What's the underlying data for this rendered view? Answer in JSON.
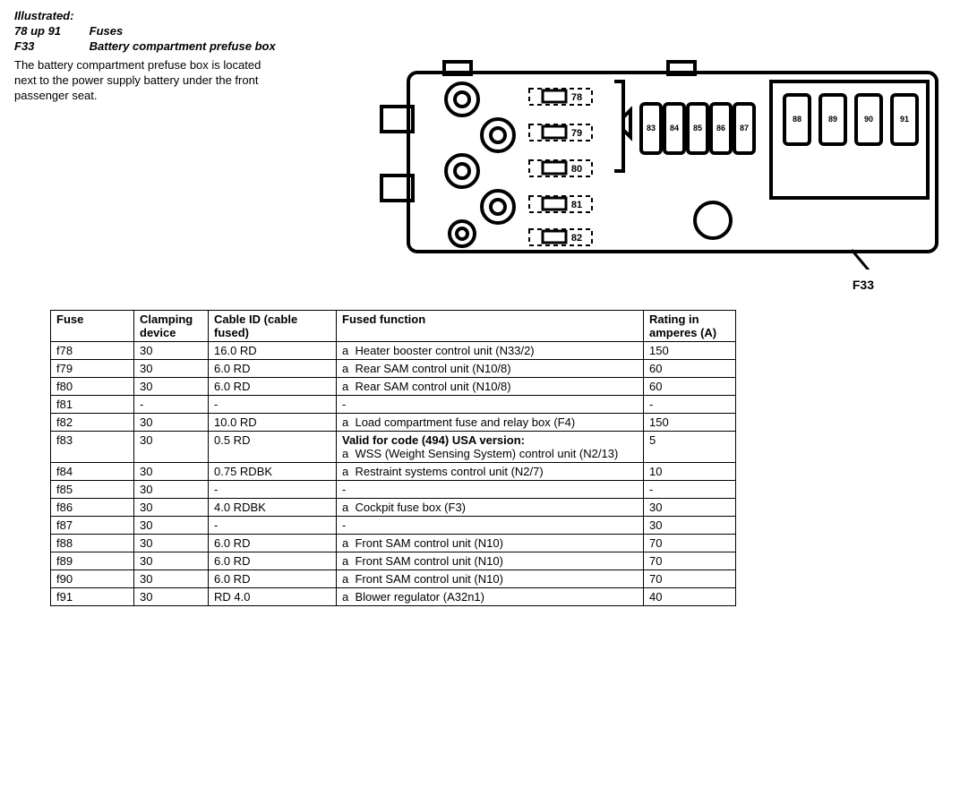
{
  "header": {
    "illustrated": "Illustrated:",
    "range_label": "78 up 91",
    "range_title": "Fuses",
    "component_id": "F33",
    "component_title": "Battery compartment prefuse box"
  },
  "description": "The battery compartment prefuse box is located next to the power supply battery under the front passenger seat.",
  "diagram": {
    "caption": "F33",
    "fuse_slots": [
      "78",
      "79",
      "80",
      "81",
      "82"
    ],
    "small_fuses": [
      "83",
      "84",
      "85",
      "86",
      "87"
    ],
    "right_fuses": [
      "88",
      "89",
      "90",
      "91"
    ]
  },
  "table": {
    "headers": {
      "fuse": "Fuse",
      "clamp": "Clamping device",
      "cable": "Cable ID (cable fused)",
      "func": "Fused function",
      "rating": "Rating in amperes (A)"
    },
    "rows": [
      {
        "fuse": "f78",
        "clamp": "30",
        "cable": "16.0 RD",
        "func": "Heater booster control unit (N33/2)",
        "func_bold": "",
        "rating": "150"
      },
      {
        "fuse": "f79",
        "clamp": "30",
        "cable": "6.0 RD",
        "func": "Rear SAM control unit (N10/8)",
        "func_bold": "",
        "rating": "60"
      },
      {
        "fuse": "f80",
        "clamp": "30",
        "cable": "6.0 RD",
        "func": "Rear SAM control unit (N10/8)",
        "func_bold": "",
        "rating": "60"
      },
      {
        "fuse": "f81",
        "clamp": "-",
        "cable": "-",
        "func": "-",
        "func_bold": "",
        "rating": "-"
      },
      {
        "fuse": "f82",
        "clamp": "30",
        "cable": "10.0 RD",
        "func": "Load compartment fuse and relay box (F4)",
        "func_bold": "",
        "rating": "150"
      },
      {
        "fuse": "f83",
        "clamp": "30",
        "cable": "0.5 RD",
        "func": "WSS (Weight Sensing System) control unit (N2/13)",
        "func_bold": "Valid for code (494) USA version:",
        "rating": "5"
      },
      {
        "fuse": "f84",
        "clamp": "30",
        "cable": "0.75 RDBK",
        "func": "Restraint systems control unit (N2/7)",
        "func_bold": "",
        "rating": "10"
      },
      {
        "fuse": "f85",
        "clamp": "30",
        "cable": "-",
        "func": "-",
        "func_bold": "",
        "rating": "-"
      },
      {
        "fuse": "f86",
        "clamp": "30",
        "cable": "4.0 RDBK",
        "func": "Cockpit fuse box (F3)",
        "func_bold": "",
        "rating": "30"
      },
      {
        "fuse": "f87",
        "clamp": "30",
        "cable": "-",
        "func": "-",
        "func_bold": "",
        "rating": "30"
      },
      {
        "fuse": "f88",
        "clamp": "30",
        "cable": "6.0 RD",
        "func": "Front SAM control unit (N10)",
        "func_bold": "",
        "rating": "70"
      },
      {
        "fuse": "f89",
        "clamp": "30",
        "cable": "6.0 RD",
        "func": "Front SAM control unit (N10)",
        "func_bold": "",
        "rating": "70"
      },
      {
        "fuse": "f90",
        "clamp": "30",
        "cable": "6.0 RD",
        "func": "Front SAM control unit (N10)",
        "func_bold": "",
        "rating": "70"
      },
      {
        "fuse": "f91",
        "clamp": "30",
        "cable": "RD 4.0",
        "func": "Blower regulator (A32n1)",
        "func_bold": "",
        "rating": "40"
      }
    ]
  }
}
